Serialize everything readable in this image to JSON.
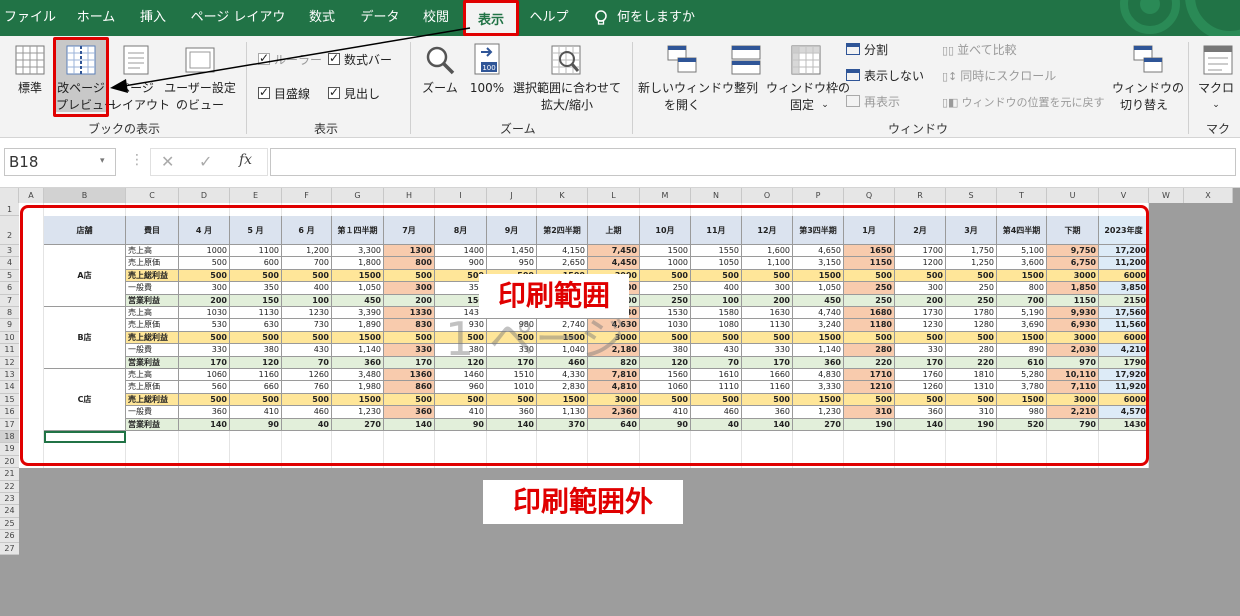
{
  "tabs": [
    "ファイル",
    "ホーム",
    "挿入",
    "ページ レイアウト",
    "数式",
    "データ",
    "校閲",
    "表示",
    "ヘルプ",
    "何をしますか"
  ],
  "active_tab": "表示",
  "ribbon": {
    "book_view": {
      "group_label": "ブックの表示",
      "normal": "標準",
      "page_break_1": "改ページ",
      "page_break_2": "プレビュー",
      "page_layout_1": "ページ",
      "page_layout_2": "レイアウト",
      "custom_1": "ユーザー設定",
      "custom_2": "のビュー"
    },
    "show": {
      "group_label": "表示",
      "ruler": "ルーラー",
      "formula_bar": "数式バー",
      "gridlines": "目盛線",
      "headings": "見出し"
    },
    "zoom": {
      "group_label": "ズーム",
      "zoom": "ズーム",
      "hundred": "100%",
      "hundred_icon": "100",
      "fit_1": "選択範囲に合わせて",
      "fit_2": "拡大/縮小"
    },
    "window": {
      "group_label": "ウィンドウ",
      "new_1": "新しいウィンドウ",
      "new_2": "を開く",
      "arrange": "整列",
      "freeze_1": "ウィンドウ枠の",
      "freeze_2": "固定",
      "split": "分割",
      "hide": "表示しない",
      "unhide": "再表示",
      "side_by_side": "並べて比較",
      "sync_scroll": "同時にスクロール",
      "reset_pos": "ウィンドウの位置を元に戻す",
      "switch_1": "ウィンドウの",
      "switch_2": "切り替え"
    },
    "macro": {
      "group_label": "マクロ",
      "macro_1": "マクロ"
    }
  },
  "formula_bar": {
    "name_box": "B18",
    "fx": "fx"
  },
  "sheet": {
    "columns": [
      "A",
      "B",
      "C",
      "D",
      "E",
      "F",
      "G",
      "H",
      "I",
      "J",
      "K",
      "L",
      "M",
      "N",
      "O",
      "P",
      "Q",
      "R",
      "S",
      "T",
      "U",
      "V",
      "W",
      "X"
    ],
    "header_row": [
      "店舗",
      "費目",
      "4 月",
      "5 月",
      "6 月",
      "第１四半期",
      "7月",
      "8月",
      "9月",
      "第2四半期",
      "上期",
      "10月",
      "11月",
      "12月",
      "第3四半期",
      "1月",
      "2月",
      "3月",
      "第4四半期",
      "下期",
      "2023年度"
    ],
    "stores": [
      "A店",
      "B店",
      "C店"
    ],
    "rows": [
      [
        "売上高",
        "1000",
        "1100",
        "1,200",
        "3,300",
        "1300",
        "1400",
        "1,450",
        "4,150",
        "7,450",
        "1500",
        "1550",
        "1,600",
        "4,650",
        "1650",
        "1700",
        "1,750",
        "5,100",
        "9,750",
        "17,200"
      ],
      [
        "売上原価",
        "500",
        "600",
        "700",
        "1,800",
        "800",
        "900",
        "950",
        "2,650",
        "4,450",
        "1000",
        "1050",
        "1,100",
        "3,150",
        "1150",
        "1200",
        "1,250",
        "3,600",
        "6,750",
        "11,200"
      ],
      [
        "売上総利益",
        "500",
        "500",
        "500",
        "1500",
        "500",
        "500",
        "500",
        "1500",
        "3000",
        "500",
        "500",
        "500",
        "1500",
        "500",
        "500",
        "500",
        "1500",
        "3000",
        "6000"
      ],
      [
        "一般費",
        "300",
        "350",
        "400",
        "1,050",
        "300",
        "350",
        "300",
        "950",
        "2,000",
        "250",
        "400",
        "300",
        "1,050",
        "250",
        "300",
        "250",
        "800",
        "1,850",
        "3,850"
      ],
      [
        "営業利益",
        "200",
        "150",
        "100",
        "450",
        "200",
        "150",
        "200",
        "550",
        "1000",
        "250",
        "100",
        "200",
        "450",
        "250",
        "200",
        "250",
        "700",
        "1150",
        "2150"
      ],
      [
        "売上高",
        "1030",
        "1130",
        "1230",
        "3,390",
        "1330",
        "1430",
        "1480",
        "4,240",
        "7,630",
        "1530",
        "1580",
        "1630",
        "4,740",
        "1680",
        "1730",
        "1780",
        "5,190",
        "9,930",
        "17,560"
      ],
      [
        "売上原価",
        "530",
        "630",
        "730",
        "1,890",
        "830",
        "930",
        "980",
        "2,740",
        "4,630",
        "1030",
        "1080",
        "1130",
        "3,240",
        "1180",
        "1230",
        "1280",
        "3,690",
        "6,930",
        "11,560"
      ],
      [
        "売上総利益",
        "500",
        "500",
        "500",
        "1500",
        "500",
        "500",
        "500",
        "1500",
        "3000",
        "500",
        "500",
        "500",
        "1500",
        "500",
        "500",
        "500",
        "1500",
        "3000",
        "6000"
      ],
      [
        "一般費",
        "330",
        "380",
        "430",
        "1,140",
        "330",
        "380",
        "330",
        "1,040",
        "2,180",
        "380",
        "430",
        "330",
        "1,140",
        "280",
        "330",
        "280",
        "890",
        "2,030",
        "4,210"
      ],
      [
        "営業利益",
        "170",
        "120",
        "70",
        "360",
        "170",
        "120",
        "170",
        "460",
        "820",
        "120",
        "70",
        "170",
        "360",
        "220",
        "170",
        "220",
        "610",
        "970",
        "1790"
      ],
      [
        "売上高",
        "1060",
        "1160",
        "1260",
        "3,480",
        "1360",
        "1460",
        "1510",
        "4,330",
        "7,810",
        "1560",
        "1610",
        "1660",
        "4,830",
        "1710",
        "1760",
        "1810",
        "5,280",
        "10,110",
        "17,920"
      ],
      [
        "売上原価",
        "560",
        "660",
        "760",
        "1,980",
        "860",
        "960",
        "1010",
        "2,830",
        "4,810",
        "1060",
        "1110",
        "1160",
        "3,330",
        "1210",
        "1260",
        "1310",
        "3,780",
        "7,110",
        "11,920"
      ],
      [
        "売上総利益",
        "500",
        "500",
        "500",
        "1500",
        "500",
        "500",
        "500",
        "1500",
        "3000",
        "500",
        "500",
        "500",
        "1500",
        "500",
        "500",
        "500",
        "1500",
        "3000",
        "6000"
      ],
      [
        "一般費",
        "360",
        "410",
        "460",
        "1,230",
        "360",
        "410",
        "360",
        "1,130",
        "2,360",
        "410",
        "460",
        "360",
        "1,230",
        "310",
        "360",
        "310",
        "980",
        "2,210",
        "4,570"
      ],
      [
        "営業利益",
        "140",
        "90",
        "40",
        "270",
        "140",
        "90",
        "140",
        "370",
        "640",
        "90",
        "40",
        "140",
        "270",
        "190",
        "140",
        "190",
        "520",
        "790",
        "1430"
      ]
    ],
    "watermark": "1 ページ",
    "print_area_label": "印刷範囲",
    "outside_label": "印刷範囲外"
  },
  "colors": {
    "ribbon_green": "#217346",
    "highlight_red": "#e00000",
    "quarter_fill": "#f8cbad",
    "gross_profit_fill": "#ffe699",
    "operating_fill": "#e2efda",
    "header_fill": "#dbe3ef",
    "total_fill": "#ddebf7"
  }
}
